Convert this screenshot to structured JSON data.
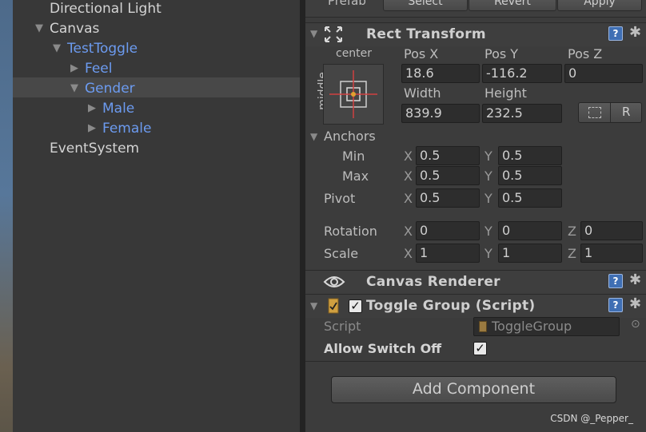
{
  "hierarchy": {
    "items": [
      {
        "label": "Directional Light"
      },
      {
        "label": "Canvas",
        "arrow": "▼"
      },
      {
        "label": "TestToggle",
        "arrow": "▼"
      },
      {
        "label": "Feel",
        "arrow": "▶"
      },
      {
        "label": "Gender",
        "arrow": "▼"
      },
      {
        "label": "Male",
        "arrow": "▶"
      },
      {
        "label": "Female",
        "arrow": "▶"
      },
      {
        "label": "EventSystem"
      }
    ]
  },
  "inspector": {
    "prefab": {
      "label": "Prefab",
      "select": "Select",
      "revert": "Revert",
      "apply": "Apply"
    },
    "rect_transform": {
      "title": "Rect Transform",
      "anchor_h": "center",
      "anchor_v": "middle",
      "pos_x_label": "Pos X",
      "pos_y_label": "Pos Y",
      "pos_z_label": "Pos Z",
      "pos_x": "18.6",
      "pos_y": "-116.2",
      "pos_z": "0",
      "width_label": "Width",
      "height_label": "Height",
      "width": "839.9",
      "height": "232.5",
      "raw_button": "R",
      "anchors_label": "Anchors",
      "min_label": "Min",
      "max_label": "Max",
      "pivot_label": "Pivot",
      "min_x": "0.5",
      "min_y": "0.5",
      "max_x": "0.5",
      "max_y": "0.5",
      "pivot_x": "0.5",
      "pivot_y": "0.5",
      "rotation_label": "Rotation",
      "rot_x": "0",
      "rot_y": "0",
      "rot_z": "0",
      "scale_label": "Scale",
      "scale_x": "1",
      "scale_y": "1",
      "scale_z": "1",
      "x": "X",
      "y": "Y",
      "z": "Z"
    },
    "canvas_renderer": {
      "title": "Canvas Renderer"
    },
    "toggle_group": {
      "title": "Toggle Group (Script)",
      "script_label": "Script",
      "script_value": "ToggleGroup",
      "allow_switch_off_label": "Allow Switch Off"
    },
    "add_component": "Add Component",
    "help_glyph": "?",
    "gear_glyph": "✱",
    "check_glyph": "✓"
  },
  "watermark": "CSDN @_Pepper_"
}
